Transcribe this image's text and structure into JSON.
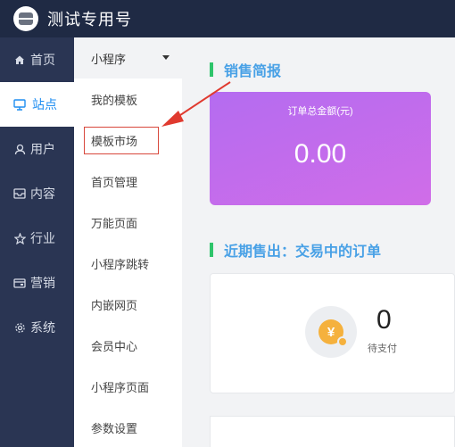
{
  "header": {
    "title": "测试专用号"
  },
  "sidebar": {
    "items": [
      {
        "label": "首页"
      },
      {
        "label": "站点"
      },
      {
        "label": "用户"
      },
      {
        "label": "内容"
      },
      {
        "label": "行业"
      },
      {
        "label": "营销"
      },
      {
        "label": "系统"
      }
    ]
  },
  "submenu": {
    "header": "小程序",
    "items": [
      "我的模板",
      "模板市场",
      "首页管理",
      "万能页面",
      "小程序跳转",
      "内嵌网页",
      "会员中心",
      "小程序页面",
      "参数设置"
    ]
  },
  "sales": {
    "section_title": "销售简报",
    "card_label": "订单总金额(元)",
    "amount": "0.00"
  },
  "orders": {
    "section_title": "近期售出：交易中的订单",
    "pending_count": "0",
    "pending_label": "待支付",
    "coin_symbol": "¥"
  },
  "colors": {
    "topbar": "#1f2a44",
    "sidebar": "#2a3553",
    "accent": "#1f8ef1",
    "section_title": "#49a1e6",
    "section_bar": "#2fc46b",
    "sales_card": "#c46cec",
    "highlight_box": "#d8483c",
    "coin": "#f5b13d"
  }
}
